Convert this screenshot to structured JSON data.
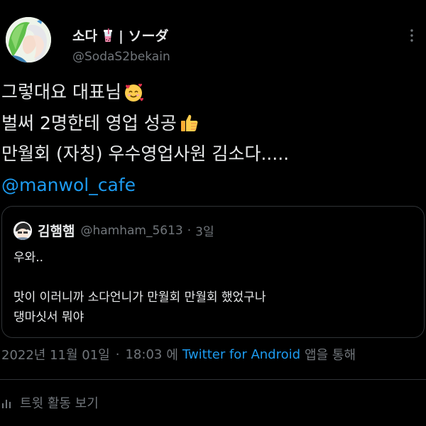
{
  "author": {
    "display_name": "소다",
    "display_name_suffix": "| ソーダ",
    "handle": "@SodaS2bekain",
    "avatar_icon": "anime-avatar-icon",
    "cup_icon": "bubble-tea-emoji"
  },
  "tweet": {
    "lines": [
      "그렇대요 대표님",
      "벌써 2명한테 영업 성공",
      "만월회 (자칭) 우수영업사원 김소다.....",
      "@manwol_cafe"
    ],
    "emojis": [
      "smiling-face-with-hearts-emoji",
      "thumbs-up-emoji"
    ]
  },
  "quote": {
    "display_name": "김햄햄",
    "handle": "@hamham_5613",
    "separator": "·",
    "time": "3일",
    "body": [
      "우와..",
      "",
      "맛이 이러니까 소다언니가 만월회 만월회 했었구나",
      "댕마싯서 뭐야"
    ]
  },
  "meta": {
    "date": "2022년 11월 01일",
    "separator": "·",
    "time": "18:03",
    "prefix": "에",
    "source": "Twitter for Android",
    "suffix": "앱을 통해"
  },
  "activity": {
    "label": "트윗 활동 보기"
  },
  "colors": {
    "background": "#000000",
    "text": "#e7e9ea",
    "secondary": "#71767b",
    "link": "#1d9bf0",
    "border": "#2f3336"
  }
}
